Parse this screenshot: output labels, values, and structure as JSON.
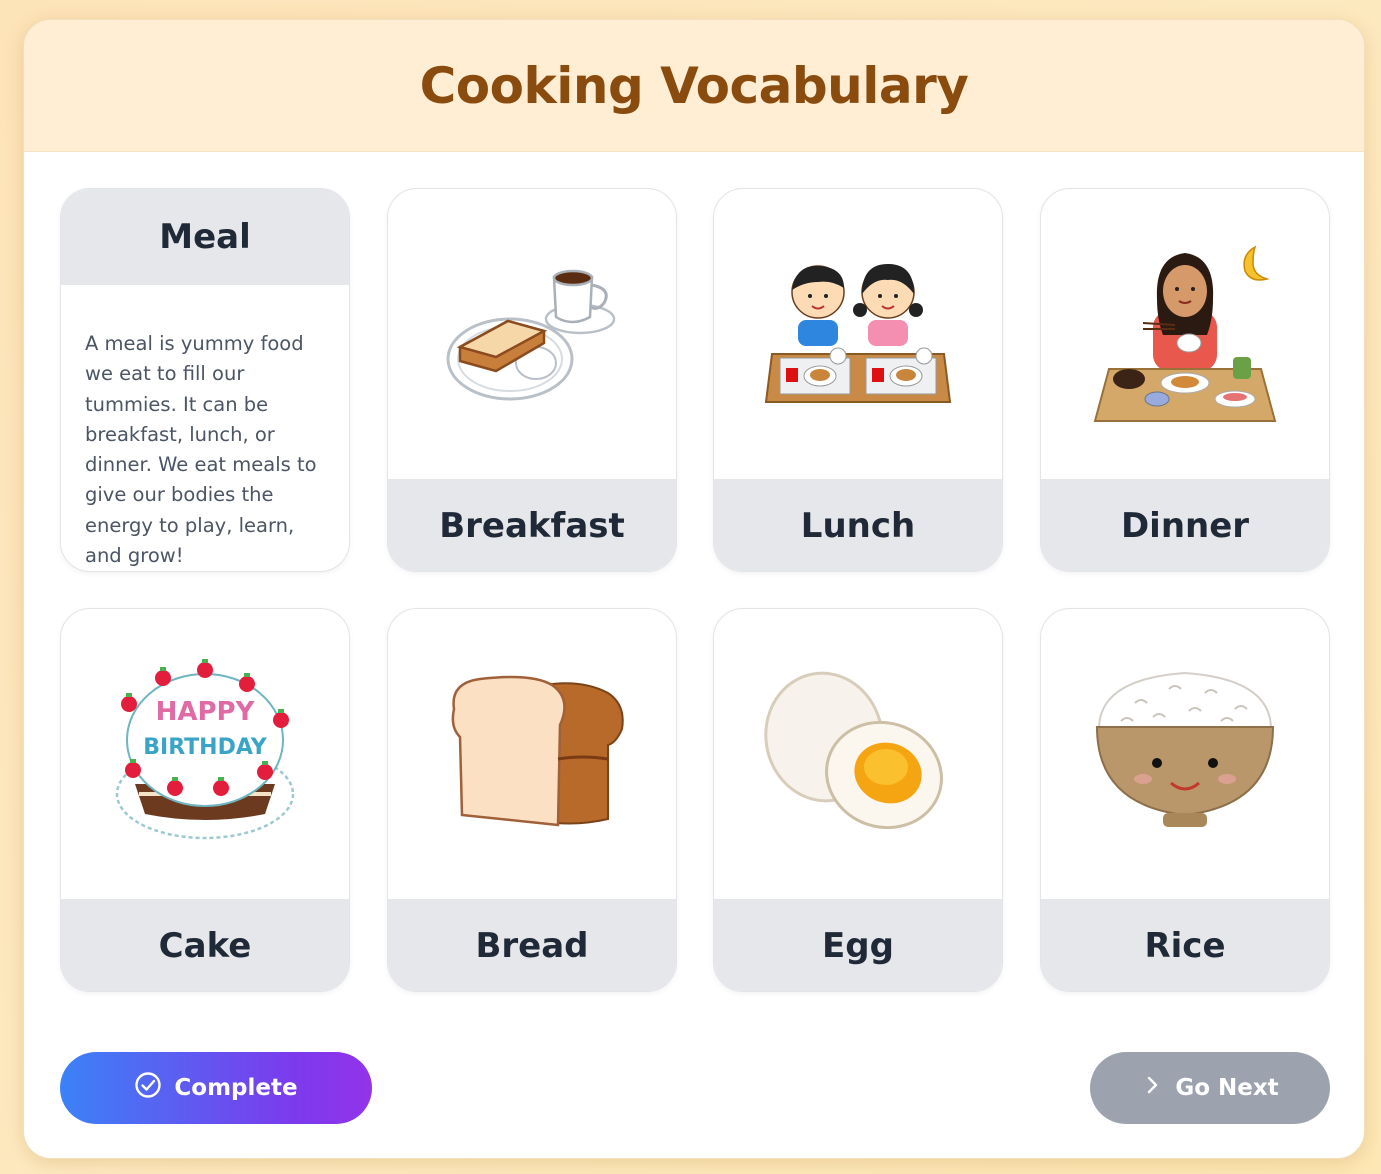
{
  "header": {
    "title": "Cooking Vocabulary"
  },
  "definition_card": {
    "title": "Meal",
    "text": "A meal is yummy food we eat to fill our tummies. It can be breakfast, lunch, or dinner. We eat meals to give our bodies the energy to play, learn, and grow!"
  },
  "cards": [
    {
      "label": "Breakfast",
      "icon": "breakfast-illustration"
    },
    {
      "label": "Lunch",
      "icon": "lunch-illustration"
    },
    {
      "label": "Dinner",
      "icon": "dinner-illustration"
    },
    {
      "label": "Cake",
      "icon": "cake-illustration",
      "cake_text_1": "HAPPY",
      "cake_text_2": "BIRTHDAY"
    },
    {
      "label": "Bread",
      "icon": "bread-illustration"
    },
    {
      "label": "Egg",
      "icon": "egg-illustration"
    },
    {
      "label": "Rice",
      "icon": "rice-illustration"
    }
  ],
  "buttons": {
    "complete_label": "Complete",
    "complete_icon": "check-circle-icon",
    "next_label": "Go Next",
    "next_icon": "chevron-right-icon"
  },
  "colors": {
    "title": "#8a4b0e",
    "header_bg": "#ffeed4",
    "label_bg": "#e6e7ea",
    "complete_gradient_start": "#3b82f6",
    "complete_gradient_end": "#9333ea",
    "next_bg": "#9ca3af"
  }
}
